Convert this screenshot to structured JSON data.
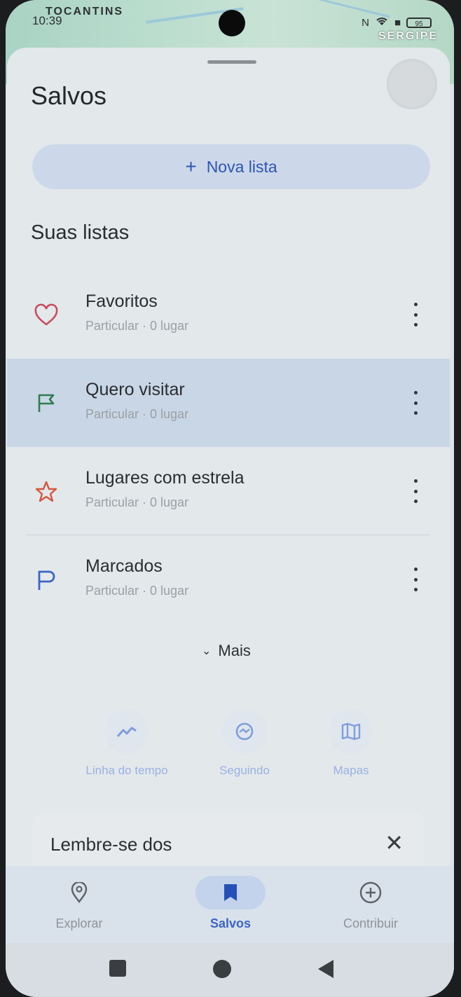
{
  "status_bar": {
    "time": "10:39",
    "map_labels": [
      "TOCANTINS",
      "SERGIPE"
    ],
    "battery": "95"
  },
  "header": {
    "title": "Salvos"
  },
  "actions": {
    "new_list_label": "Nova lista"
  },
  "lists_section": {
    "title": "Suas listas",
    "items": [
      {
        "name": "Favoritos",
        "meta": "Particular · 0 lugar",
        "icon": "heart-icon",
        "color": "#c94c5f"
      },
      {
        "name": "Quero visitar",
        "meta": "Particular · 0 lugar",
        "icon": "flag-icon",
        "color": "#2e7d4f"
      },
      {
        "name": "Lugares com estrela",
        "meta": "Particular · 0 lugar",
        "icon": "star-icon",
        "color": "#d4583d"
      },
      {
        "name": "Marcados",
        "meta": "Particular · 0 lugar",
        "icon": "pennant-icon",
        "color": "#3d63c5"
      }
    ],
    "more_label": "Mais"
  },
  "shortcuts": [
    {
      "label": "Linha do tempo",
      "icon": "timeline-icon"
    },
    {
      "label": "Seguindo",
      "icon": "following-icon"
    },
    {
      "label": "Mapas",
      "icon": "map-icon"
    }
  ],
  "reminder_card": {
    "title": "Lembre-se dos"
  },
  "bottom_nav": {
    "items": [
      {
        "label": "Explorar",
        "icon": "location-pin-icon"
      },
      {
        "label": "Salvos",
        "icon": "bookmark-icon",
        "active": true
      },
      {
        "label": "Contribuir",
        "icon": "add-circle-icon"
      }
    ]
  },
  "colors": {
    "accent": "#3d63c5",
    "sheet": "#e3e8eb",
    "highlight": "#c9d6e6"
  }
}
